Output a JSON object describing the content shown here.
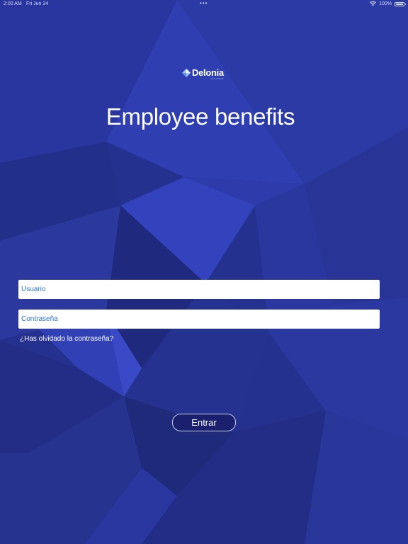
{
  "status_bar": {
    "time": "2:00 AM",
    "date": "Fri Jun 24",
    "dots": "•••",
    "battery_text": "100%",
    "battery_level": 1.0,
    "wifi_icon": "wifi-icon"
  },
  "logo": {
    "text": "Delonia",
    "subtext": "SOFTWARE"
  },
  "title": "Employee benefits",
  "form": {
    "username_placeholder": "Usuario",
    "password_placeholder": "Contraseña",
    "forgot_password": "¿Has olvidado la contraseña?",
    "submit_label": "Entrar"
  },
  "colors": {
    "background": "#25318f",
    "button_bg": "#1a206e",
    "input_text": "#2a74cc"
  }
}
